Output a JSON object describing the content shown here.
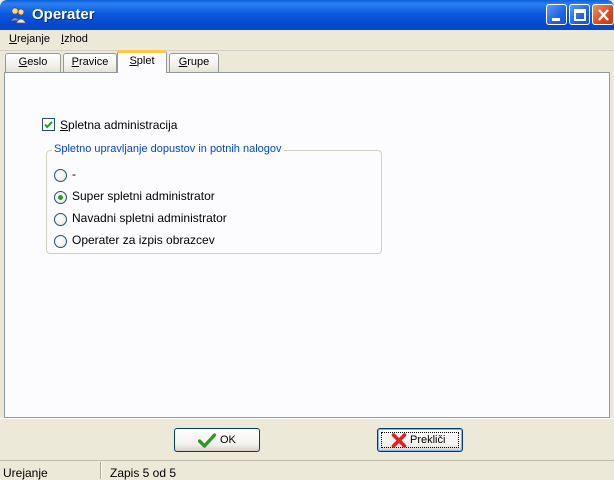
{
  "window": {
    "title": "Operater",
    "controls": [
      "minimize-icon",
      "maximize-icon",
      "close-icon"
    ]
  },
  "menu": {
    "items": [
      {
        "underline": "U",
        "rest": "rejanje"
      },
      {
        "underline": "I",
        "rest": "zhod"
      }
    ]
  },
  "tabs": [
    {
      "underline": "G",
      "rest": "eslo",
      "active": false
    },
    {
      "underline": "P",
      "rest": "ravice",
      "active": false
    },
    {
      "underline": "S",
      "rest": "plet",
      "active": true
    },
    {
      "underline": "G",
      "rest": "rupe",
      "active": false
    }
  ],
  "splet": {
    "checkbox": {
      "underline": "S",
      "rest": "pletna administracija",
      "checked": true
    },
    "group": {
      "legend": "Spletno upravljanje dopustov in potnih nalogov",
      "options": [
        {
          "label": "-",
          "selected": false
        },
        {
          "label": "Super spletni administrator",
          "selected": true
        },
        {
          "label": "Navadni spletni administrator",
          "selected": false
        },
        {
          "label": "Operater za izpis obrazcev",
          "selected": false
        }
      ]
    }
  },
  "buttons": {
    "ok": {
      "label": "OK",
      "icon": "checkmark-icon"
    },
    "cancel": {
      "label": "Prekliči",
      "icon": "x-cross-icon"
    }
  },
  "status": {
    "left": "Urejanje",
    "record": "Zapis 5 od 5"
  },
  "colors": {
    "titlebar": "#0a5fd8",
    "legend": "#0046d5",
    "tab_highlight": "#ffc83c",
    "radio_dot": "#2f9a2f",
    "cancel_icon": "#e02020",
    "ok_icon": "#2c9a2c"
  }
}
